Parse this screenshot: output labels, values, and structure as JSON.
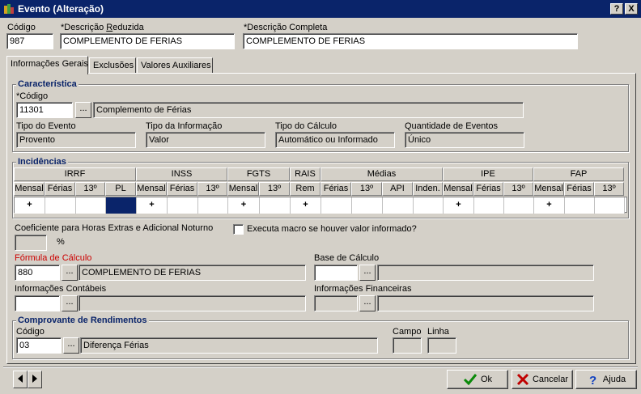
{
  "window": {
    "title": "Evento (Alteração)",
    "help_btn": "?",
    "close_btn": "X"
  },
  "header": {
    "codigo_label": "Código",
    "codigo_value": "987",
    "desc_red_label_prefix": "*Descrição ",
    "desc_red_label_u": "R",
    "desc_red_label_suffix": "eduzida",
    "desc_red_value": "COMPLEMENTO DE FERIAS",
    "desc_comp_label": "*Descrição Completa",
    "desc_comp_value": "COMPLEMENTO DE FERIAS"
  },
  "tabs": [
    {
      "label": "Informações Gerais"
    },
    {
      "label": "Exclusões"
    },
    {
      "label": "Valores Auxiliares"
    }
  ],
  "caracteristica": {
    "title": "Característica",
    "codigo_label": "*Código",
    "codigo_value": "11301",
    "codigo_desc": "Complemento de Férias",
    "tipo_evento_label": "Tipo do Evento",
    "tipo_evento_value": "Provento",
    "tipo_info_label": "Tipo da Informação",
    "tipo_info_value": "Valor",
    "tipo_calc_label": "Tipo do Cálculo",
    "tipo_calc_value": "Automático ou Informado",
    "qtd_label": "Quantidade de Eventos",
    "qtd_value": "Único"
  },
  "incidencias": {
    "title": "Incidências",
    "groups": [
      "IRRF",
      "INSS",
      "FGTS",
      "RAIS",
      "Médias",
      "IPE",
      "FAP"
    ],
    "columns": [
      "Mensal",
      "Férias",
      "13º",
      "PL",
      "Mensal",
      "Férias",
      "13º",
      "Mensal",
      "13º",
      "Rem",
      "Férias",
      "13º",
      "API",
      "Inden.",
      "Mensal",
      "Férias",
      "13º",
      "Mensal",
      "Férias",
      "13º"
    ],
    "values": [
      "+",
      "",
      "",
      "",
      "+",
      "",
      "",
      "+",
      "",
      "+",
      "",
      "",
      "",
      "",
      "+",
      "",
      "",
      "+",
      "",
      ""
    ]
  },
  "coeficiente": {
    "label": "Coeficiente para Horas Extras e Adicional Noturno",
    "value": "",
    "unit": "%"
  },
  "macro": {
    "label": "Executa macro se houver valor informado?"
  },
  "formula": {
    "label": "Fórmula de Cálculo",
    "value": "880",
    "desc": "COMPLEMENTO DE FERIAS"
  },
  "base_calculo": {
    "label": "Base de Cálculo",
    "value": "",
    "desc": ""
  },
  "contabeis": {
    "label": "Informações Contábeis",
    "value": "",
    "desc": ""
  },
  "financeiras": {
    "label": "Informações Financeiras",
    "value": "",
    "desc": ""
  },
  "comprovante": {
    "title": "Comprovante de Rendimentos",
    "codigo_label": "Código",
    "codigo_value": "03",
    "codigo_desc": "Diferença Férias",
    "campo_label": "Campo",
    "linha_label": "Linha"
  },
  "dots": "...",
  "buttons": {
    "ok": "Ok",
    "cancelar": "Cancelar",
    "ajuda": "Ajuda"
  },
  "colors": {
    "titlebar": "#0a246a",
    "window": "#d4d0c8",
    "group_title": "#0a246a",
    "required_red": "#cc0000"
  }
}
